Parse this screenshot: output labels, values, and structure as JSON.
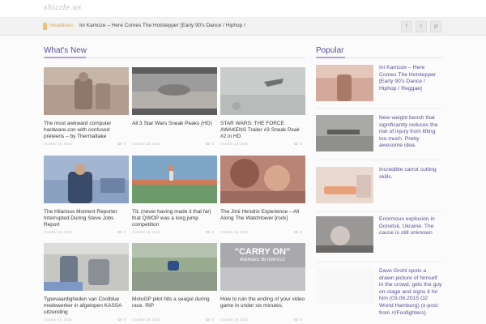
{
  "site": {
    "logo": "shizzle.us"
  },
  "headlines": {
    "label": "Headlines",
    "text": "Ini Kamoze – Here Comes The Hotstepper [Early 90's Dance / Hiphop /",
    "social": [
      "f",
      "t",
      "yt"
    ]
  },
  "whats_new": {
    "title": "What's New",
    "cards": [
      {
        "title": "The most awkward computer hardware-con with confused preteens – by Thermaltake",
        "date": "October 18, 2015",
        "comments": "0",
        "thumb_color": "#b29c8e"
      },
      {
        "title": "All 3 Star Wars Sneak Peaks (HD)",
        "date": "October 18, 2015",
        "comments": "0",
        "thumb_color": "#9c9c9c"
      },
      {
        "title": "STAR WARS: THE FORCE AWAKENS Trailer #3 Sneak Peak #2 in HD",
        "date": "October 18, 2015",
        "comments": "0",
        "thumb_color": "#c8cccb"
      },
      {
        "title": "The Hilarious Moment Reporter Interrupted During Steve Jobs Report",
        "date": "October 18, 2015",
        "comments": "0",
        "thumb_color": "#8aa1c2"
      },
      {
        "title": "TIL (never having made it that far) that QWOP was a long jump competition",
        "date": "October 18, 2015",
        "comments": "0",
        "thumb_color": "#7fa6c6"
      },
      {
        "title": "The Jimi Hendrix Experience – All Along The Watchtower [rock]",
        "date": "October 18, 2015",
        "comments": "0",
        "thumb_color": "#b98476"
      },
      {
        "title": "Typevaardigheden van Coolblue medewerker in afgelopen KASSA uitzending",
        "date": "October 18, 2015",
        "comments": "0",
        "thumb_color": "#c6c7c3"
      },
      {
        "title": "MotoGP pilot hits a seagul during race. RIP",
        "date": "October 18, 2015",
        "comments": "0",
        "thumb_color": "#98ab8e"
      },
      {
        "title": "How to ruin the ending of your video game in under six minutes.",
        "date": "October 18, 2015",
        "comments": "0",
        "thumb_color": "#a9a9ad",
        "thumb_text": "\"CARRY ON\"",
        "thumb_subtext": "AVENGED SEVENFOLD"
      }
    ]
  },
  "popular": {
    "title": "Popular",
    "items": [
      {
        "title": "Ini Kamoze – Here Comes The Hotstepper [Early 90's Dance / Hiphop / Reggae]",
        "thumb_color": "#d2a99a"
      },
      {
        "title": "New weight bench that significantly reduces the risk of injury from lifting too much. Pretty awesome idea.",
        "thumb_color": "#a9aaa8"
      },
      {
        "title": "Incredible carrot cutting skills.",
        "thumb_color": "#ead9d0"
      },
      {
        "title": "Enormous explosion in Donetsk, Ukraine. The cause is still unknown",
        "thumb_color": "#9a9897"
      },
      {
        "title": "Dave Grohl spots a drawn picture of himself in the crowd, gets the guy on-stage and signs it for him (03.06.2015 O2 World Hamburg) (x-post from /r/Foofighters)",
        "thumb_color": "#f8f8f8"
      }
    ]
  }
}
